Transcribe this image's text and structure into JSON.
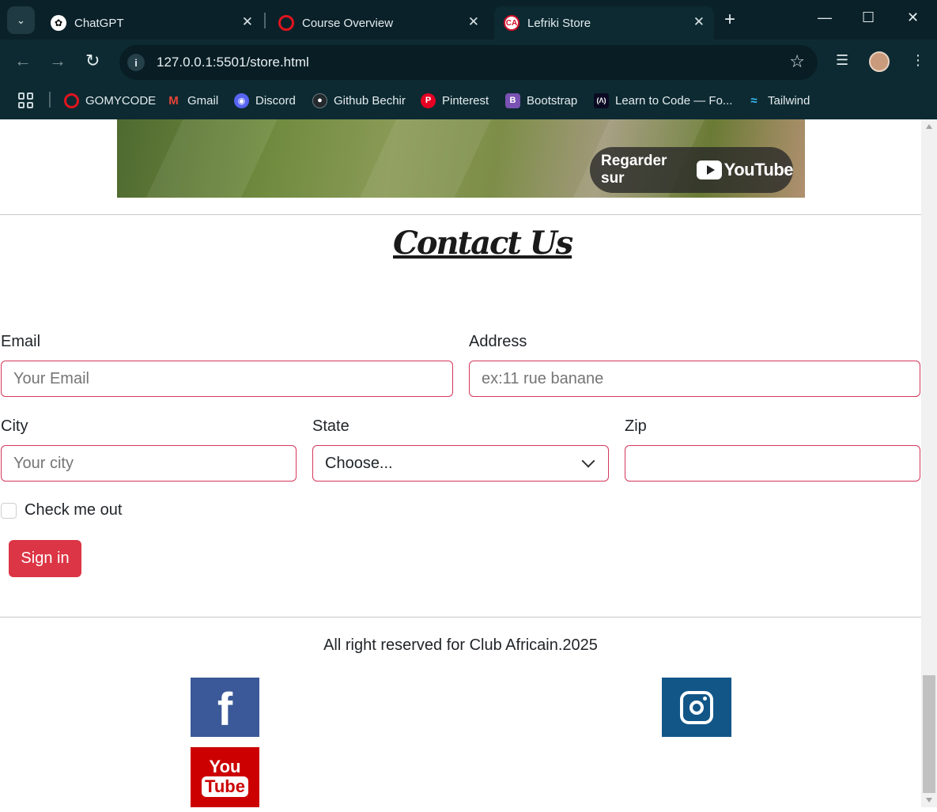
{
  "browser": {
    "tabs": [
      {
        "title": "ChatGPT",
        "icon": "chatgpt-icon"
      },
      {
        "title": "Course Overview",
        "icon": "gomycode-icon"
      },
      {
        "title": "Lefriki Store",
        "icon": "club-africain-icon",
        "active": true
      }
    ],
    "url": "127.0.0.1:5501/store.html",
    "bookmarks": [
      {
        "label": "GOMYCODE",
        "color": "#e0141e"
      },
      {
        "label": "Gmail",
        "color": "#ea4335"
      },
      {
        "label": "Discord",
        "color": "#5865f2"
      },
      {
        "label": "Github Bechir",
        "color": "#24292e"
      },
      {
        "label": "Pinterest",
        "color": "#e60023"
      },
      {
        "label": "Bootstrap",
        "color": "#7952b3"
      },
      {
        "label": "Learn to Code — Fo...",
        "color": "#0a0a23"
      },
      {
        "label": "Tailwind",
        "color": "#38bdf8"
      }
    ]
  },
  "video": {
    "watch_on": "Regarder sur",
    "brand": "YouTube"
  },
  "contact": {
    "title": "Contact Us",
    "email_label": "Email",
    "email_placeholder": "Your Email",
    "address_label": "Address",
    "address_placeholder": "ex:11 rue banane",
    "city_label": "City",
    "city_placeholder": "Your city",
    "state_label": "State",
    "state_selected": "Choose...",
    "zip_label": "Zip",
    "zip_value": "",
    "check_label": "Check me out",
    "submit_label": "Sign in"
  },
  "footer": {
    "text": "All right reserved for Club Africain.2025",
    "social": {
      "facebook_glyph": "f",
      "youtube_you": "You",
      "youtube_tube": "Tube"
    }
  },
  "colors": {
    "input_border": "#d4375a",
    "button": "#dc3545",
    "facebook": "#3b5998",
    "instagram": "#125688",
    "youtube": "#cc0000"
  }
}
